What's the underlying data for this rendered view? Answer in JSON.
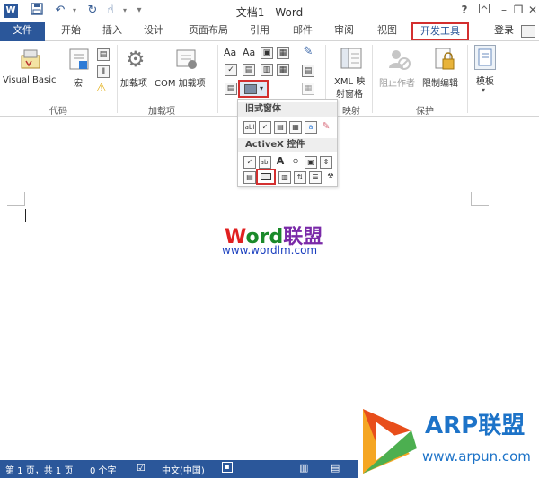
{
  "window": {
    "title": "文档1 - Word",
    "help": "?",
    "app_logo_letter": "W"
  },
  "tabs": {
    "file": "文件",
    "home": "开始",
    "insert": "插入",
    "design": "设计",
    "layout": "页面布局",
    "references": "引用",
    "mailings": "邮件",
    "review": "审阅",
    "view": "视图",
    "developer": "开发工具",
    "login": "登录"
  },
  "ribbon": {
    "code_group": {
      "visual_basic": "Visual Basic",
      "macros": "宏",
      "label": "代码"
    },
    "addins_group": {
      "addins": "加载项",
      "com_addins": "COM 加载项",
      "label": "加载项"
    },
    "controls_group": {
      "aa_rich": "Aa",
      "aa_plain": "Aa"
    },
    "mapping_group": {
      "xml_mapping_line1": "XML 映",
      "xml_mapping_line2": "射窗格",
      "label": "映射"
    },
    "protect_group": {
      "block_authors": "阻止作者",
      "restrict_editing": "限制编辑",
      "label": "保护"
    },
    "templates_group": {
      "templates": "模板"
    }
  },
  "dropdown": {
    "legacy_header": "旧式窗体",
    "activex_header": "ActiveX 控件",
    "legacy_text_icon": "abl",
    "activex_text_icon": "abl",
    "activex_label_icon": "A"
  },
  "watermark": {
    "word_part_w": "W",
    "word_part_ord": "ord",
    "word_part_cn": "联盟",
    "url": "www.wordlm.com"
  },
  "status": {
    "page": "第 1 页，共 1 页",
    "words": "0 个字",
    "language": "中文(中国)"
  },
  "corner_logo": {
    "title": "ARP联盟",
    "url": "www.arpun.com"
  },
  "colors": {
    "accent": "#2b579a",
    "highlight_box": "#d32f2f",
    "wm_w": "#e02020",
    "wm_ord": "#1a8a2a",
    "wm_cn": "#7a2aa8",
    "arp": "#1d73c8"
  }
}
